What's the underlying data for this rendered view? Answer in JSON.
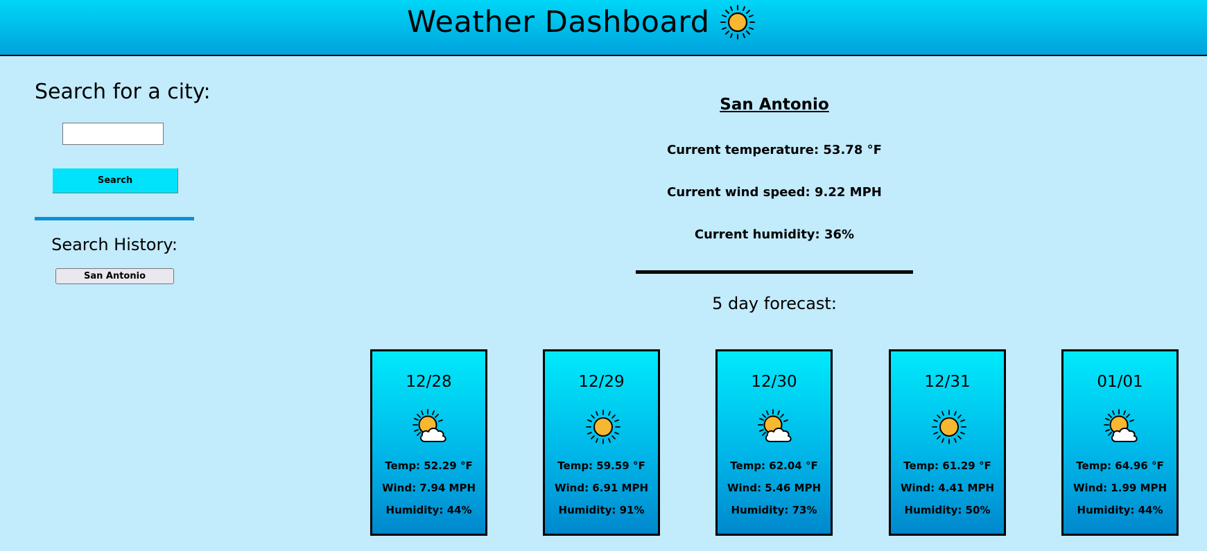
{
  "header": {
    "title": "Weather Dashboard",
    "icon": "sun-icon"
  },
  "sidebar": {
    "search_heading": "Search for a city:",
    "search_input": {
      "value": "",
      "placeholder": ""
    },
    "search_button_label": "Search",
    "history_heading": "Search History:",
    "history_items": [
      {
        "label": "San Antonio"
      }
    ]
  },
  "current": {
    "city": "San Antonio",
    "temperature": "Current temperature: 53.78 °F",
    "wind": "Current wind speed: 9.22 MPH",
    "humidity": "Current humidity: 36%"
  },
  "forecast": {
    "heading": "5 day forecast:",
    "days": [
      {
        "date": "12/28",
        "icon": "partly-cloudy-icon",
        "temp": "Temp: 52.29 °F",
        "wind": "Wind: 7.94 MPH",
        "humidity": "Humidity: 44%"
      },
      {
        "date": "12/29",
        "icon": "sun-icon",
        "temp": "Temp: 59.59 °F",
        "wind": "Wind: 6.91 MPH",
        "humidity": "Humidity: 91%"
      },
      {
        "date": "12/30",
        "icon": "partly-cloudy-icon",
        "temp": "Temp: 62.04 °F",
        "wind": "Wind: 5.46 MPH",
        "humidity": "Humidity: 73%"
      },
      {
        "date": "12/31",
        "icon": "sun-icon",
        "temp": "Temp: 61.29 °F",
        "wind": "Wind: 4.41 MPH",
        "humidity": "Humidity: 50%"
      },
      {
        "date": "01/01",
        "icon": "partly-cloudy-icon",
        "temp": "Temp: 64.96 °F",
        "wind": "Wind: 1.99 MPH",
        "humidity": "Humidity: 44%"
      }
    ]
  },
  "colors": {
    "background": "#c2ebfc",
    "header_top": "#00d6f7",
    "header_bottom": "#00a3dc",
    "search_button": "#00e3fa",
    "sidebar_divider": "#0b8fd6",
    "sun": "#f7b731"
  }
}
